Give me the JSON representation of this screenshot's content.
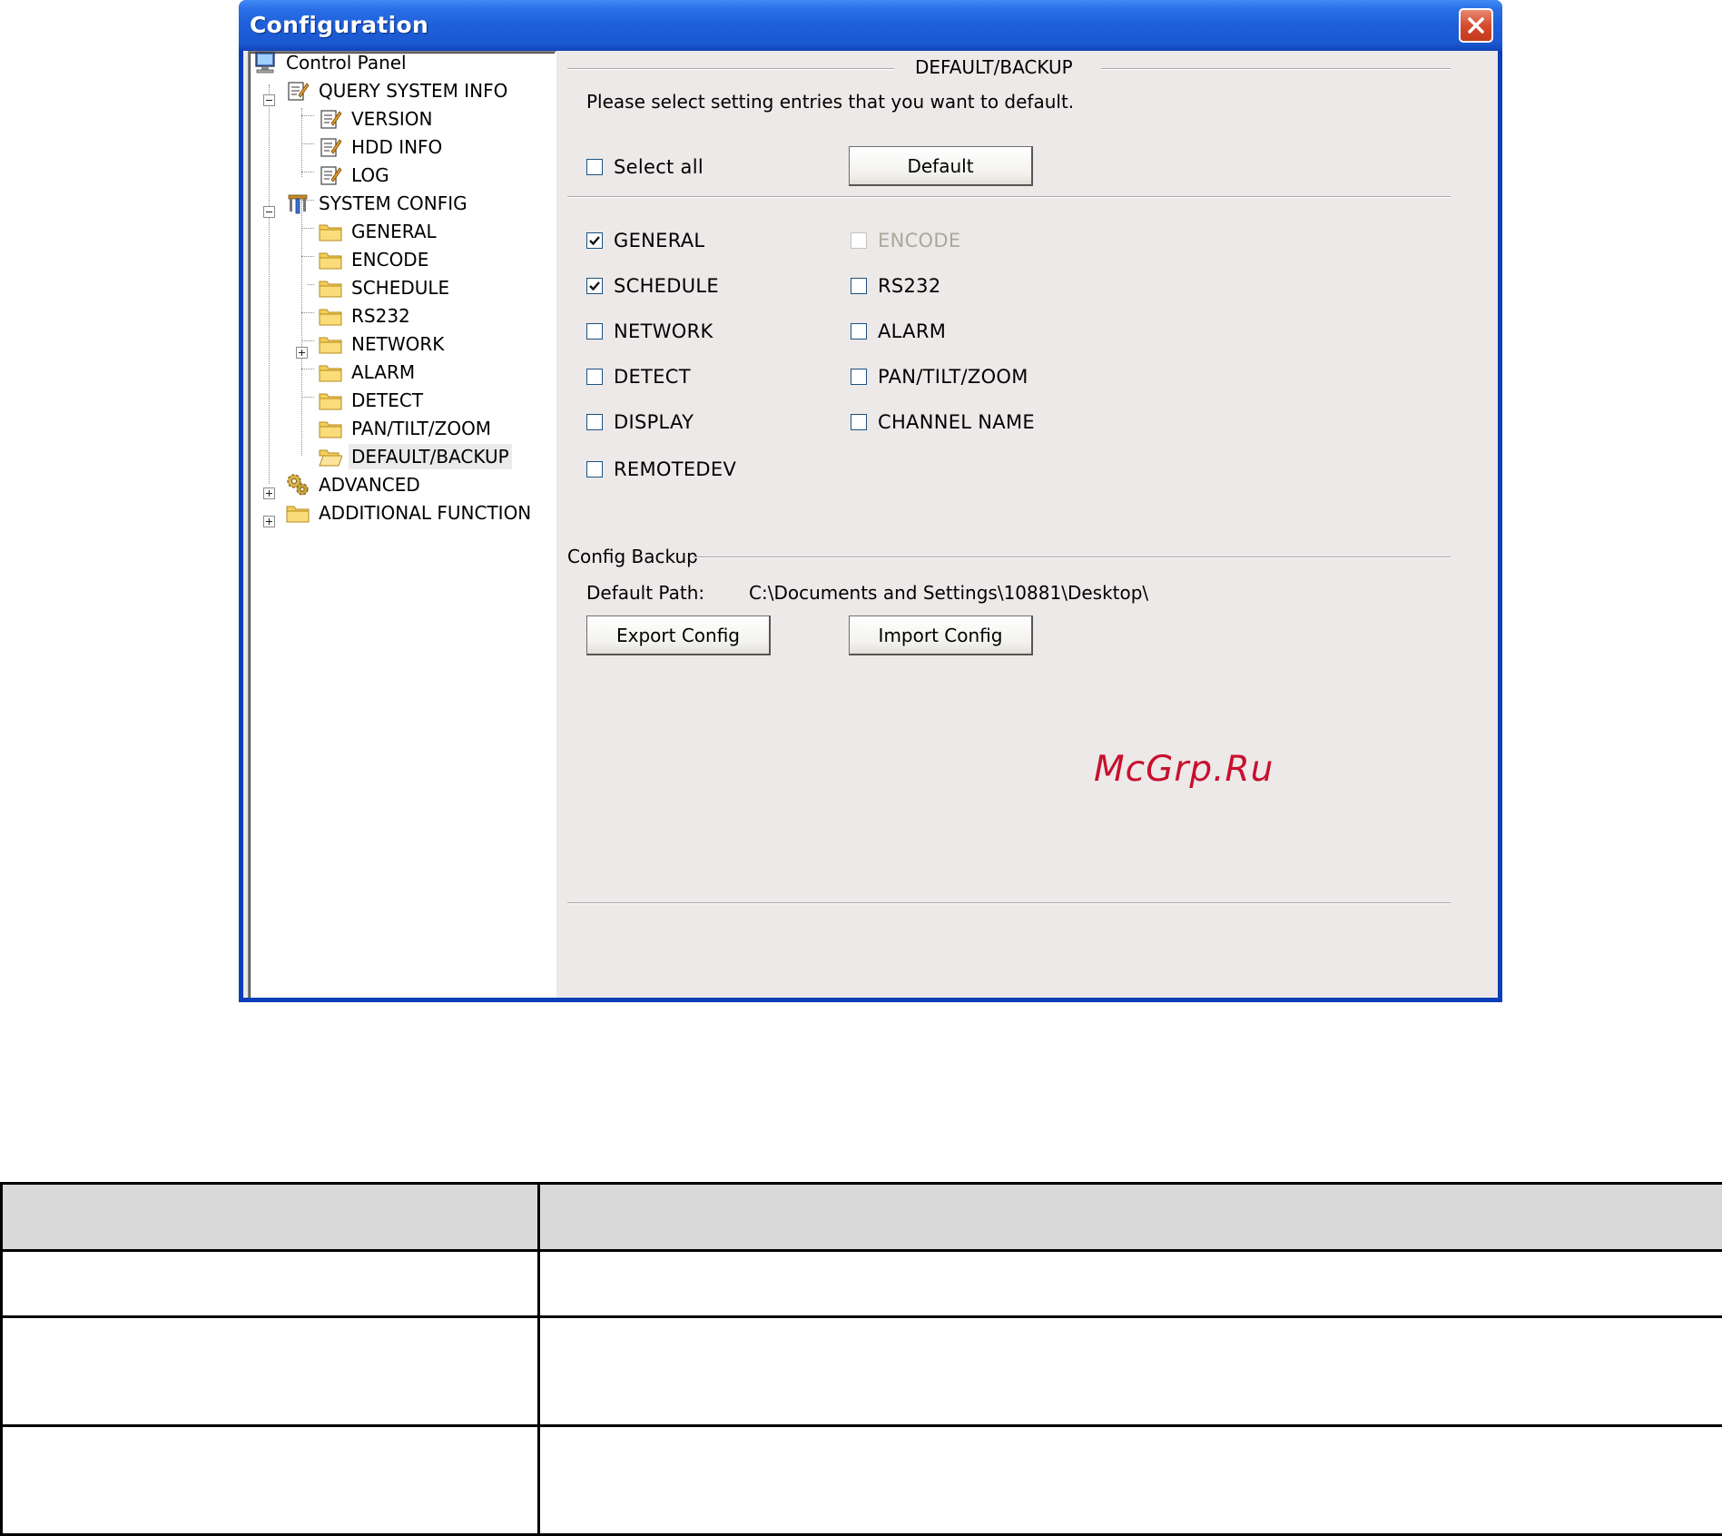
{
  "window": {
    "title": "Configuration"
  },
  "tree": {
    "root": "Control Panel",
    "query_system_info": {
      "label": "QUERY SYSTEM INFO",
      "children": [
        "VERSION",
        "HDD INFO",
        "LOG"
      ]
    },
    "system_config": {
      "label": "SYSTEM CONFIG",
      "children": [
        "GENERAL",
        "ENCODE",
        "SCHEDULE",
        "RS232",
        "NETWORK",
        "ALARM",
        "DETECT",
        "PAN/TILT/ZOOM",
        "DEFAULT/BACKUP"
      ]
    },
    "advanced": "ADVANCED",
    "additional_function": "ADDITIONAL FUNCTION",
    "selected": "DEFAULT/BACKUP"
  },
  "panel": {
    "group_title": "DEFAULT/BACKUP",
    "instruction": "Please select setting entries that you want to default.",
    "select_all": {
      "label": "Select all",
      "checked": false
    },
    "default_button": "Default",
    "entries": [
      {
        "label": "GENERAL",
        "checked": true,
        "enabled": true
      },
      {
        "label": "ENCODE",
        "checked": false,
        "enabled": false
      },
      {
        "label": "SCHEDULE",
        "checked": true,
        "enabled": true
      },
      {
        "label": "RS232",
        "checked": false,
        "enabled": true
      },
      {
        "label": "NETWORK",
        "checked": false,
        "enabled": true
      },
      {
        "label": "ALARM",
        "checked": false,
        "enabled": true
      },
      {
        "label": "DETECT",
        "checked": false,
        "enabled": true
      },
      {
        "label": "PAN/TILT/ZOOM",
        "checked": false,
        "enabled": true
      },
      {
        "label": "DISPLAY",
        "checked": false,
        "enabled": true
      },
      {
        "label": "CHANNEL NAME",
        "checked": false,
        "enabled": true
      },
      {
        "label": "REMOTEDEV",
        "checked": false,
        "enabled": true
      }
    ],
    "backup": {
      "title": "Config Backup",
      "path_label": "Default Path:",
      "path_value": "C:\\Documents and Settings\\10881\\Desktop\\",
      "export_button": "Export Config",
      "import_button": "Import Config"
    }
  },
  "watermark": "McGrp.Ru",
  "colors": {
    "title_bar": "#1e5fd9",
    "close_button": "#d3472a",
    "dialog_bg": "#ece9e8",
    "watermark": "#c8102e",
    "table_header": "#d9d9d9"
  }
}
